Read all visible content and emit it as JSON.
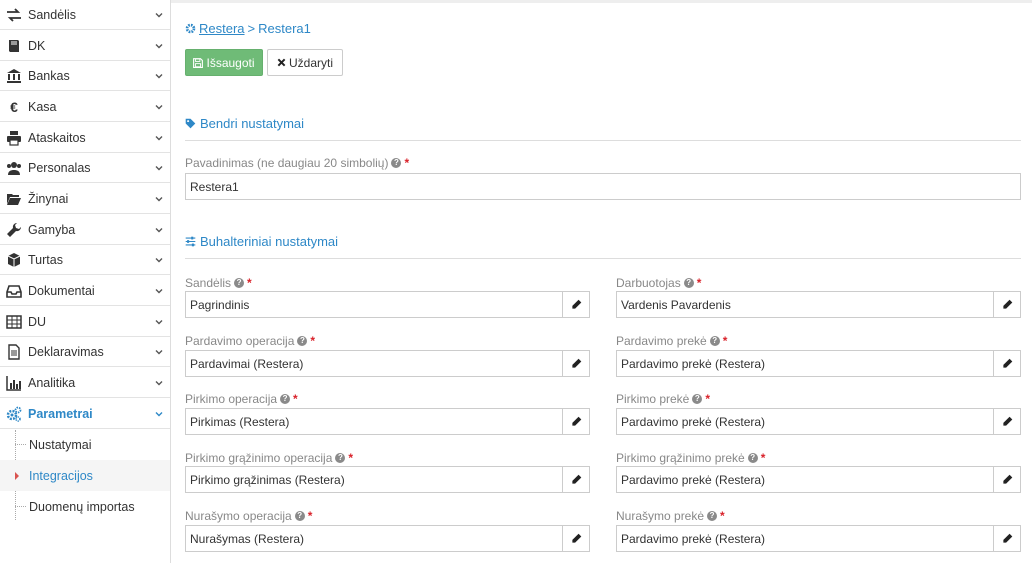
{
  "sidebar": {
    "items": [
      {
        "label": "Sandėlis",
        "icon": "exchange-icon"
      },
      {
        "label": "DK",
        "icon": "book-icon"
      },
      {
        "label": "Bankas",
        "icon": "bank-icon"
      },
      {
        "label": "Kasa",
        "icon": "euro-icon"
      },
      {
        "label": "Ataskaitos",
        "icon": "print-icon"
      },
      {
        "label": "Personalas",
        "icon": "users-icon"
      },
      {
        "label": "Žinynai",
        "icon": "folder-open-icon"
      },
      {
        "label": "Gamyba",
        "icon": "wrench-icon"
      },
      {
        "label": "Turtas",
        "icon": "cube-icon"
      },
      {
        "label": "Dokumentai",
        "icon": "inbox-icon"
      },
      {
        "label": "DU",
        "icon": "table-icon"
      },
      {
        "label": "Deklaravimas",
        "icon": "file-text-icon"
      },
      {
        "label": "Analitika",
        "icon": "bar-chart-icon"
      },
      {
        "label": "Parametrai",
        "icon": "cogs-icon"
      }
    ],
    "subitems": [
      {
        "label": "Nustatymai"
      },
      {
        "label": "Integracijos"
      },
      {
        "label": "Duomenų importas"
      }
    ]
  },
  "breadcrumb": {
    "parent": "Restera",
    "separator": ">",
    "current": "Restera1"
  },
  "toolbar": {
    "save_label": "Išsaugoti",
    "close_label": "Uždaryti"
  },
  "sections": {
    "general": "Bendri nustatymai",
    "accounting": "Buhalteriniai nustatymai"
  },
  "fields": {
    "name": {
      "label": "Pavadinimas (ne daugiau 20 simbolių)",
      "value": "Restera1"
    },
    "warehouse": {
      "label": "Sandėlis",
      "value": "Pagrindinis"
    },
    "employee": {
      "label": "Darbuotojas",
      "value": "Vardenis Pavardenis"
    },
    "sale_operation": {
      "label": "Pardavimo operacija",
      "value": "Pardavimai (Restera)"
    },
    "sale_product": {
      "label": "Pardavimo prekė",
      "value": "Pardavimo prekė (Restera)"
    },
    "purchase_operation": {
      "label": "Pirkimo operacija",
      "value": "Pirkimas (Restera)"
    },
    "purchase_product": {
      "label": "Pirkimo prekė",
      "value": "Pardavimo prekė (Restera)"
    },
    "purchase_return_operation": {
      "label": "Pirkimo grąžinimo operacija",
      "value": "Pirkimo grąžinimas (Restera)"
    },
    "purchase_return_product": {
      "label": "Pirkimo grąžinimo prekė",
      "value": "Pardavimo prekė (Restera)"
    },
    "writeoff_operation": {
      "label": "Nurašymo operacija",
      "value": "Nurašymas (Restera)"
    },
    "writeoff_product": {
      "label": "Nurašymo prekė",
      "value": "Pardavimo prekė (Restera)"
    }
  },
  "colors": {
    "accent": "#2e88c7",
    "save_button": "#6fbb77",
    "required": "#d9222a"
  }
}
